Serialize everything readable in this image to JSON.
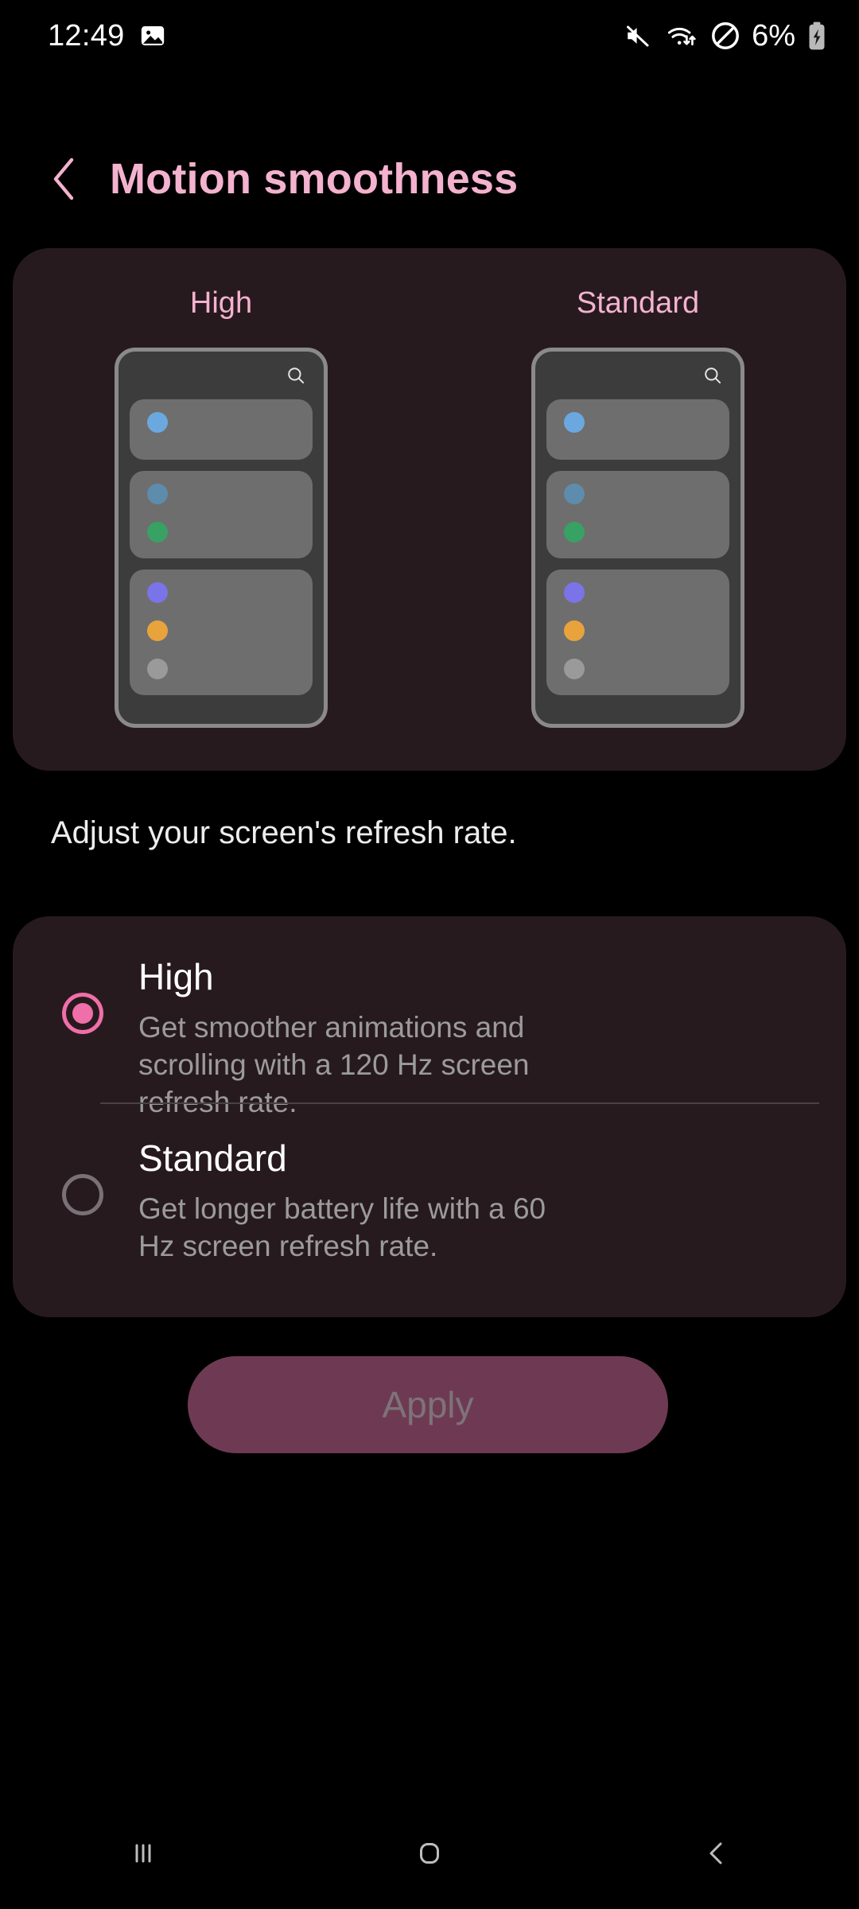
{
  "statusbar": {
    "time": "12:49",
    "battery_percent": "6%",
    "icons": {
      "photo": "image-icon",
      "mute": "volume-mute-icon",
      "wifi": "wifi-transfer-icon",
      "dnd": "do-not-disturb-icon",
      "battery": "battery-charging-icon"
    }
  },
  "header": {
    "back": "back-chevron-icon",
    "title": "Motion smoothness",
    "title_color": "#F3B2CE"
  },
  "preview": {
    "card_color": "#271A1F",
    "columns": [
      {
        "label": "High",
        "search_icon": "search-icon",
        "rows": [
          {
            "dots": [
              "#6CA8E0"
            ]
          },
          {
            "dots": [
              "#5E8CAD",
              "#37A263"
            ]
          },
          {
            "dots": [
              "#7B74E8",
              "#E8A33C",
              "#9A9A9A"
            ]
          }
        ]
      },
      {
        "label": "Standard",
        "search_icon": "search-icon",
        "rows": [
          {
            "dots": [
              "#6CA8E0"
            ]
          },
          {
            "dots": [
              "#5E8CAD",
              "#37A263"
            ]
          },
          {
            "dots": [
              "#7B74E8",
              "#E8A33C",
              "#9A9A9A"
            ]
          }
        ]
      }
    ]
  },
  "description": "Adjust your screen's refresh rate.",
  "options": {
    "selected_index": 0,
    "accent_color": "#F06FA8",
    "items": [
      {
        "title": "High",
        "subtitle": "Get smoother animations and scrolling with a 120 Hz screen refresh rate.",
        "selected": true
      },
      {
        "title": "Standard",
        "subtitle": "Get longer battery life with a 60 Hz screen refresh rate.",
        "selected": false
      }
    ]
  },
  "apply": {
    "label": "Apply",
    "enabled": false,
    "bg_color": "#6E3A53",
    "text_color": "#7E7378"
  },
  "navbar": {
    "recents": "recents-icon",
    "home": "home-icon",
    "back": "back-icon"
  }
}
